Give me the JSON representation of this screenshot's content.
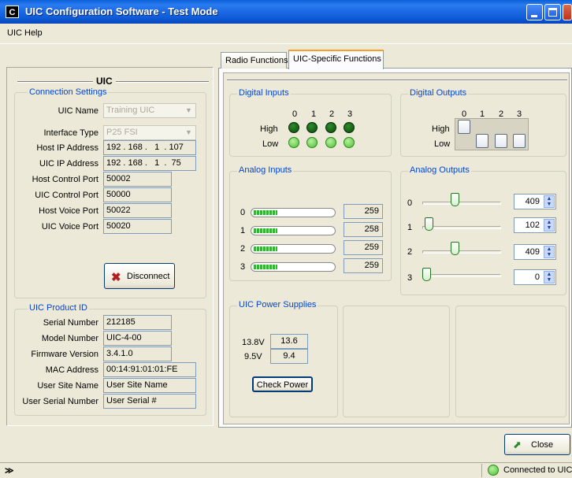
{
  "window": {
    "title": "UIC Configuration Software - Test Mode",
    "icon_text": "C"
  },
  "menu": {
    "uic": "UIC",
    "help": "Help"
  },
  "left": {
    "group_title": "UIC",
    "connection": {
      "title": "Connection Settings",
      "uic_name_label": "UIC Name",
      "uic_name_value": "Training UIC",
      "interface_label": "Interface Type",
      "interface_value": "P25 FSI",
      "host_ip_label": "Host IP Address",
      "host_ip_value": "192 . 168 .   1  . 107",
      "uic_ip_label": "UIC IP Address",
      "uic_ip_value": "192 . 168 .   1  .  75",
      "host_ctrl_label": "Host Control Port",
      "host_ctrl_value": "50002",
      "uic_ctrl_label": "UIC Control Port",
      "uic_ctrl_value": "50000",
      "host_voice_label": "Host Voice Port",
      "host_voice_value": "50022",
      "uic_voice_label": "UIC Voice Port",
      "uic_voice_value": "50020",
      "disconnect_label": "Disconnect"
    },
    "product": {
      "title": "UIC Product ID",
      "serial_label": "Serial Number",
      "serial_value": "212185",
      "model_label": "Model Number",
      "model_value": "UIC-4-00",
      "firmware_label": "Firmware Version",
      "firmware_value": "3.4.1.0",
      "mac_label": "MAC Address",
      "mac_value": "00:14:91:01:01:FE",
      "site_label": "User Site Name",
      "site_value": "User Site Name",
      "userserial_label": "User Serial Number",
      "userserial_value": "User Serial #"
    }
  },
  "tabs": {
    "radio": "Radio Functions",
    "uic": "UIC-Specific Functions"
  },
  "digital_inputs": {
    "title": "Digital Inputs",
    "cols": [
      "0",
      "1",
      "2",
      "3"
    ],
    "high": "High",
    "low": "Low"
  },
  "digital_outputs": {
    "title": "Digital Outputs",
    "cols": [
      "0",
      "1",
      "2",
      "3"
    ],
    "high": "High",
    "low": "Low"
  },
  "analog_inputs": {
    "title": "Analog Inputs",
    "rows": [
      {
        "ch": "0",
        "value": "259"
      },
      {
        "ch": "1",
        "value": "258"
      },
      {
        "ch": "2",
        "value": "259"
      },
      {
        "ch": "3",
        "value": "259"
      }
    ]
  },
  "analog_outputs": {
    "title": "Analog Outputs",
    "rows": [
      {
        "ch": "0",
        "value": "409"
      },
      {
        "ch": "1",
        "value": "102"
      },
      {
        "ch": "2",
        "value": "409"
      },
      {
        "ch": "3",
        "value": "0"
      }
    ]
  },
  "power": {
    "title": "UIC Power Supplies",
    "v1_label": "13.8V",
    "v1_value": "13.6",
    "v2_label": "9.5V",
    "v2_value": "9.4",
    "check_label": "Check Power"
  },
  "close_label": "Close",
  "status": {
    "expand_glyph": "≫",
    "connected": "Connected to UIC"
  },
  "colors": {
    "accent": "#0046d5",
    "led_green": "#3cb82c"
  }
}
